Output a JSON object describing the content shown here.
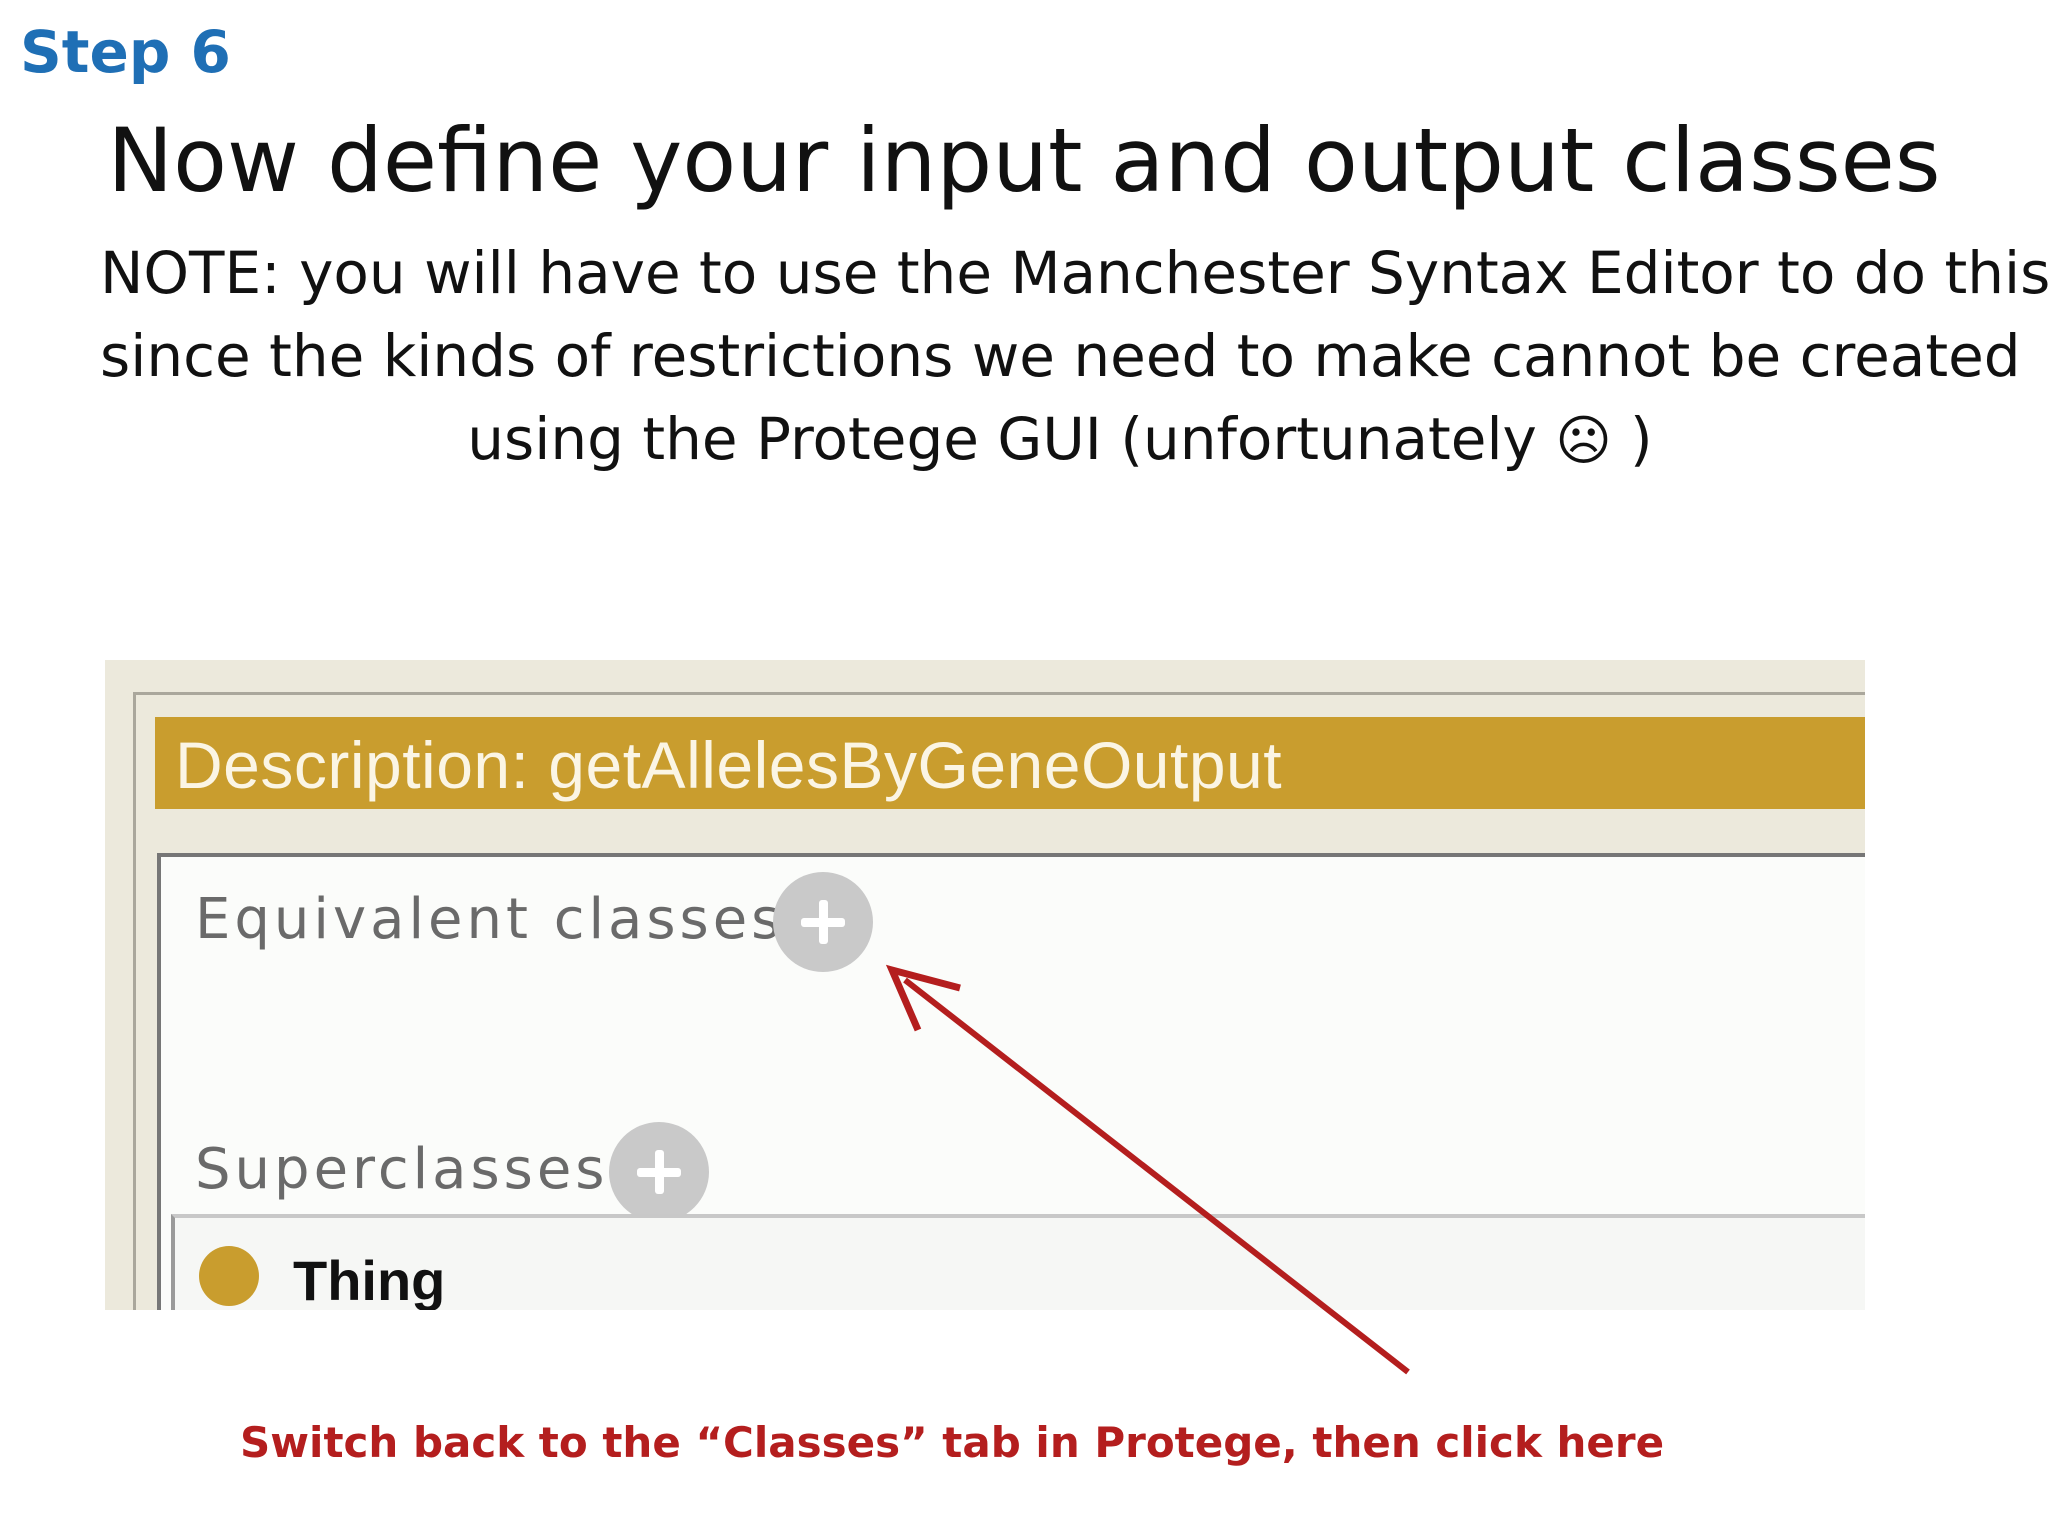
{
  "slide": {
    "step": "Step 6",
    "title": "Now define your input and output classes",
    "note_lines": [
      "NOTE:  you will have to use the Manchester Syntax Editor to do this,",
      "since the kinds of restrictions we need to make cannot be created",
      "using the Protege GUI (unfortunately "
    ],
    "note_tail": " )",
    "frown_glyph": "☹",
    "frown_icon": "frown-face-icon"
  },
  "screenshot": {
    "header": "Description: getAllelesByGeneOutput",
    "equivalent_label": "Equivalent classes",
    "superclasses_label": "Superclasses",
    "add_icon": "plus-circle-icon",
    "superclass_item": "Thing",
    "class_icon": "class-circle-icon",
    "colors": {
      "header_bg": "#c99d2e",
      "panel_bg": "#ece9dc",
      "add_button": "#c9c9c9"
    }
  },
  "annotation": {
    "caption": "Switch back to the “Classes” tab in Protege, then click here",
    "arrow_color": "#b41e1e"
  }
}
